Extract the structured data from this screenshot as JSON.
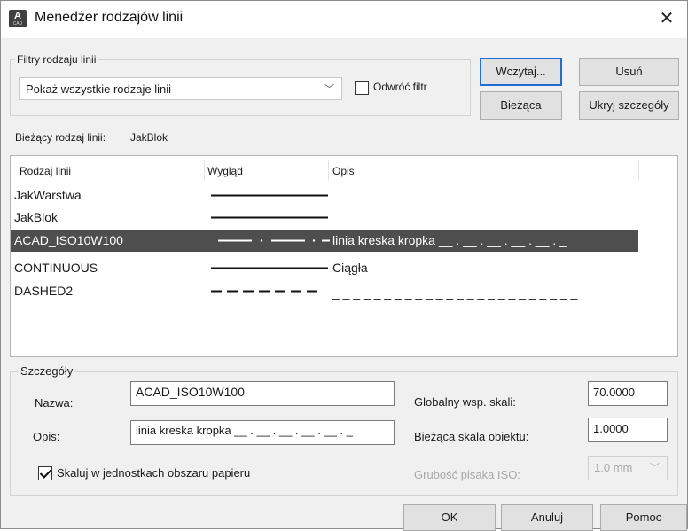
{
  "window": {
    "title": "Menedżer rodzajów linii",
    "close_glyph": "✕"
  },
  "filters": {
    "group_label": "Filtry rodzaju linii",
    "dropdown_value": "Pokaż wszystkie rodzaje linii",
    "invert_label": "Odwróć filtr",
    "invert_checked": false
  },
  "buttons": {
    "load": "Wczytaj...",
    "delete": "Usuń",
    "current": "Bieżąca",
    "hide_details": "Ukryj szczegóły",
    "ok": "OK",
    "cancel": "Anuluj",
    "help": "Pomoc"
  },
  "current_linetype": {
    "label": "Bieżący rodzaj linii:",
    "value": "JakBlok"
  },
  "table": {
    "columns": [
      "Rodzaj linii",
      "Wygląd",
      "Opis"
    ],
    "rows": [
      {
        "name": "JakWarstwa",
        "pattern": "solid",
        "description": ""
      },
      {
        "name": "JakBlok",
        "pattern": "solid",
        "description": ""
      },
      {
        "name": "ACAD_ISO10W100",
        "pattern": "dash-dot",
        "description": "linia kreska kropka __ . __ . __ . __ . __ . _",
        "selected": true
      },
      {
        "name": "CONTINUOUS",
        "pattern": "solid",
        "description": "Ciągła"
      },
      {
        "name": "DASHED2",
        "pattern": "dashed",
        "description": "_ _ _ _ _ _ _ _ _ _ _ _ _ _ _ _ _ _ _ _ _ _ _ _"
      }
    ]
  },
  "details": {
    "group_label": "Szczegóły",
    "name_label": "Nazwa:",
    "name_value": "ACAD_ISO10W100",
    "desc_label": "Opis:",
    "desc_value": "linia kreska kropka __ . __ . __ . __ . __ . _",
    "global_scale_label": "Globalny wsp. skali:",
    "global_scale_value": "70.0000",
    "object_scale_label": "Bieżąca skala obiektu:",
    "object_scale_value": "1.0000",
    "iso_pen_label": "Grubość pisaka ISO:",
    "iso_pen_value": "1.0 mm",
    "paper_units_label": "Skaluj w jednostkach obszaru papieru",
    "paper_units_checked": true
  },
  "icons": {
    "app": "autocad-app-icon",
    "app_letter": "A",
    "app_sub": "CAD"
  },
  "colors": {
    "selection": "#4e4e4e",
    "default_button_border": "#1e6fd0"
  }
}
